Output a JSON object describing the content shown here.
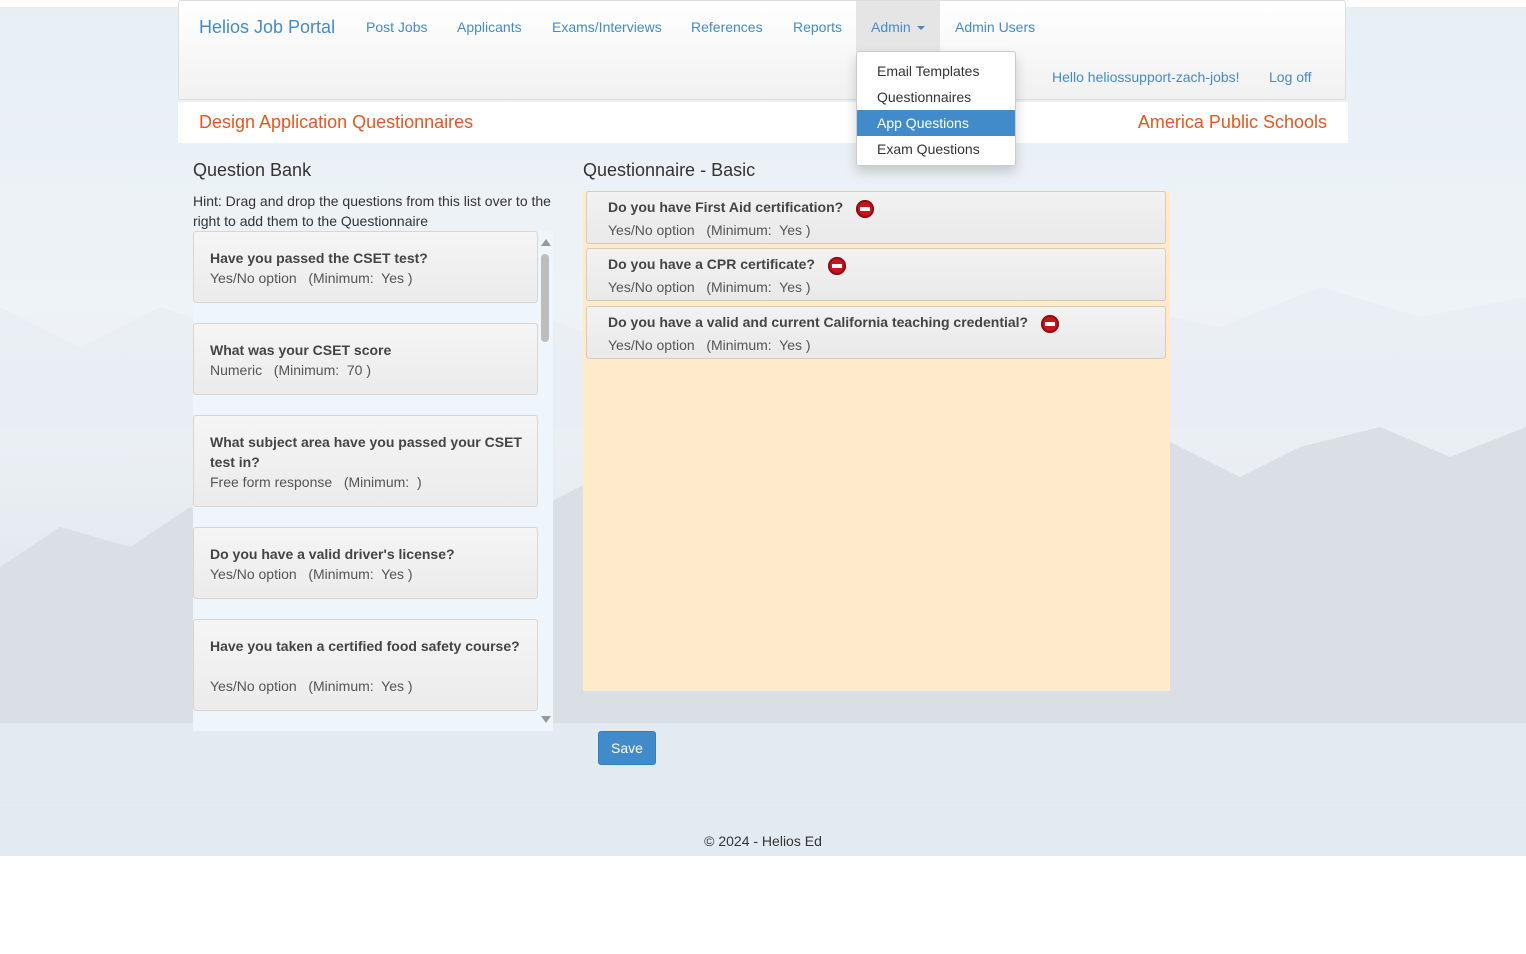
{
  "nav": {
    "brand": "Helios Job Portal",
    "links": [
      "Post Jobs",
      "Applicants",
      "Exams/Interviews",
      "References",
      "Reports"
    ],
    "admin": "Admin",
    "admin_users": "Admin Users",
    "greeting": "Hello heliossupport-zach-jobs!",
    "logoff": "Log off"
  },
  "admin_menu": {
    "items": [
      "Email Templates",
      "Questionnaires",
      "App Questions",
      "Exam Questions"
    ],
    "active": "App Questions"
  },
  "header": {
    "title": "Design Application Questionnaires",
    "school": "America Public Schools",
    "accent_color": "#e8561d"
  },
  "bank": {
    "heading": "Question Bank",
    "hint": "Hint: Drag and drop the questions from this list over to the right to add them to the Questionnaire",
    "items": [
      {
        "question": "Have you passed the CSET test?",
        "detail": "Yes/No option   (Minimum:  Yes )"
      },
      {
        "question": "What was your CSET score",
        "detail": "Numeric   (Minimum:  70 )"
      },
      {
        "question": "What subject area have you passed your CSET test in?",
        "detail": "Free form response   (Minimum:  )"
      },
      {
        "question": "Do you have a valid driver's license?",
        "detail": "Yes/No option   (Minimum:  Yes )"
      },
      {
        "question": "Have you taken a certified food safety course?",
        "detail": "Yes/No option   (Minimum:  Yes )"
      }
    ]
  },
  "questionnaire": {
    "heading": "Questionnaire - Basic",
    "items": [
      {
        "question": "Do you have First Aid certification?",
        "detail": "Yes/No option   (Minimum:  Yes )"
      },
      {
        "question": "Do you have a CPR certificate?",
        "detail": "Yes/No option   (Minimum:  Yes )"
      },
      {
        "question": "Do you have a valid and current California teaching credential?",
        "detail": "Yes/No option   (Minimum:  Yes )"
      }
    ]
  },
  "save_label": "Save",
  "footer": "© 2024 - Helios Ed"
}
